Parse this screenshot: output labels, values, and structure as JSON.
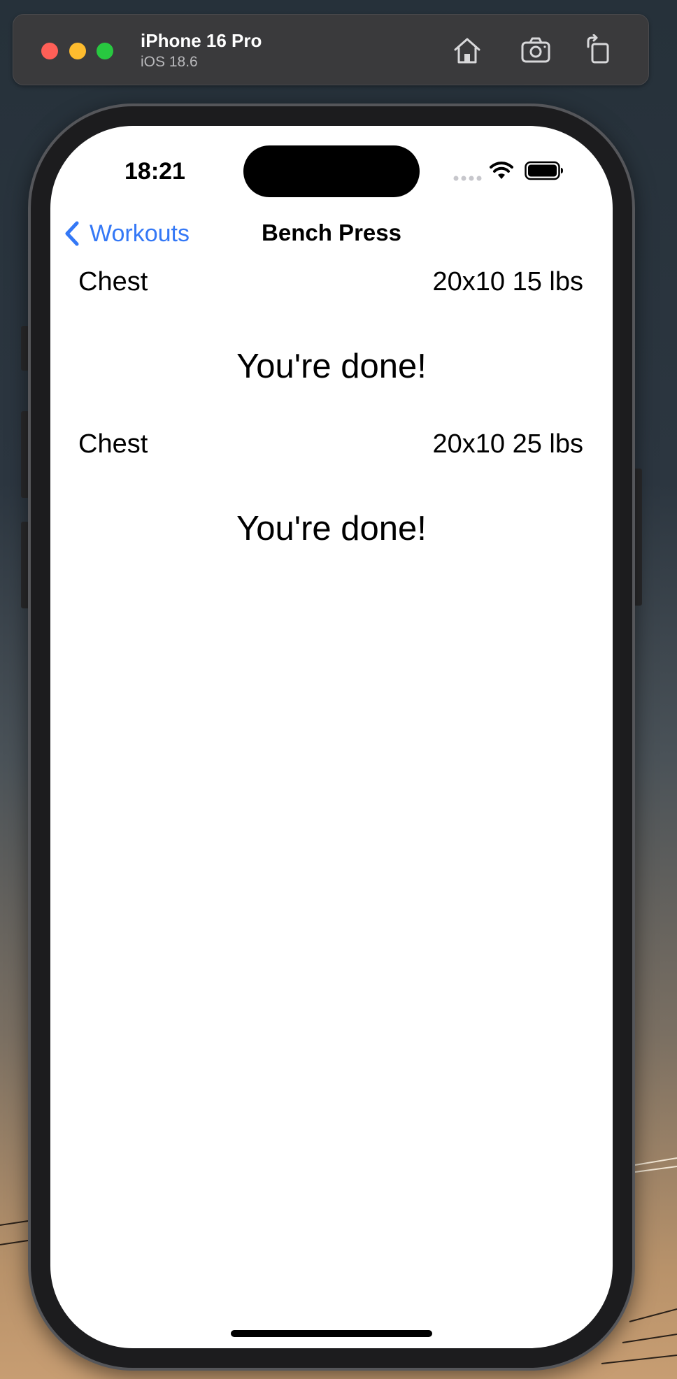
{
  "simulator": {
    "device_name": "iPhone 16 Pro",
    "os_version": "iOS 18.6",
    "toolbar_icons": [
      "home-icon",
      "screenshot-icon",
      "rotate-icon"
    ]
  },
  "status_bar": {
    "time": "18:21"
  },
  "nav": {
    "back_label": "Workouts",
    "title": "Bench Press"
  },
  "sets": [
    {
      "muscle": "Chest",
      "detail": "20x10 15 lbs",
      "status": "You're done!"
    },
    {
      "muscle": "Chest",
      "detail": "20x10 25 lbs",
      "status": "You're done!"
    }
  ],
  "colors": {
    "accent": "#3478f6",
    "screen_background": "#ffffff",
    "toolbar_background": "#3a3a3c"
  }
}
